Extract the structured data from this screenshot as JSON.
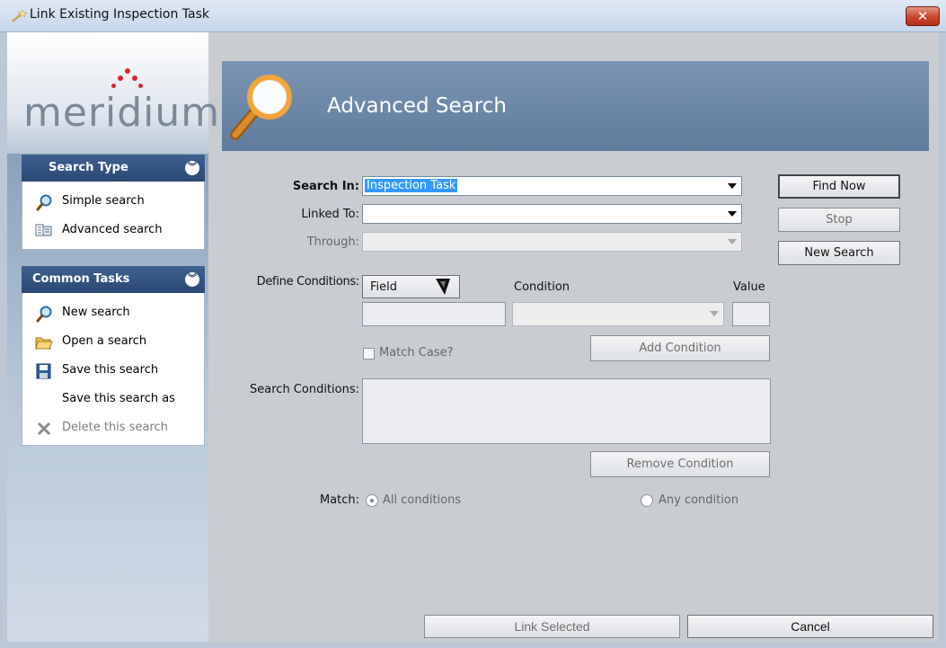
{
  "window": {
    "title": "Link Existing Inspection Task",
    "close_glyph": "✕"
  },
  "logo": {
    "text": "meridium"
  },
  "search_type": {
    "header": "Search Type",
    "items": [
      {
        "label": "Simple search",
        "icon": "magnifier-icon"
      },
      {
        "label": "Advanced search",
        "icon": "advanced-search-icon"
      }
    ]
  },
  "common_tasks": {
    "header": "Common Tasks",
    "items": [
      {
        "label": "New search",
        "icon": "magnifier-icon",
        "enabled": true
      },
      {
        "label": "Open a search",
        "icon": "folder-open-icon",
        "enabled": true
      },
      {
        "label": "Save this search",
        "icon": "floppy-disk-icon",
        "enabled": true
      },
      {
        "label": "Save this search as",
        "icon": "",
        "enabled": true
      },
      {
        "label": "Delete this search",
        "icon": "delete-x-icon",
        "enabled": false
      }
    ]
  },
  "banner": {
    "title": "Advanced Search"
  },
  "form": {
    "search_in_label": "Search In:",
    "search_in_value": "Inspection Task",
    "linked_to_label": "Linked To:",
    "linked_to_value": "",
    "through_label": "Through:",
    "through_value": "",
    "define_conditions_label": "Define Conditions:",
    "field_button_label": "Field",
    "condition_header": "Condition",
    "value_header": "Value",
    "match_case_label": "Match Case?",
    "add_condition_label": "Add Condition",
    "search_conditions_label": "Search Conditions:",
    "remove_condition_label": "Remove Condition",
    "match_label": "Match:",
    "all_conditions_label": "All conditions",
    "any_condition_label": "Any condition",
    "match_selected": "All conditions"
  },
  "actions": {
    "find_now": "Find Now",
    "stop": "Stop",
    "new_search": "New Search"
  },
  "footer": {
    "link_selected": "Link Selected",
    "cancel": "Cancel"
  },
  "colors": {
    "banner": "#6e89aa",
    "pane_header": "#2b4873",
    "selection": "#3399ff",
    "close_button": "#c9452d",
    "logo_dots": "#d7262e"
  }
}
